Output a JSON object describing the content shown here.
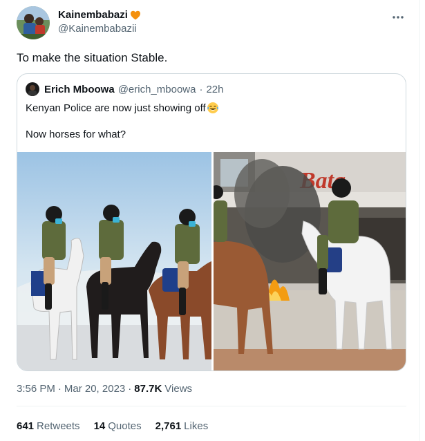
{
  "author": {
    "display_name": "Kainembabazi",
    "handle": "@Kainembabazii",
    "name_badge_icon": "orange-heart-icon",
    "avatar_icon": "avatar-image"
  },
  "tweet": {
    "text": "To make the situation Stable."
  },
  "quote": {
    "display_name": "Erich Mboowa",
    "handle": "@erich_mboowa",
    "dot": "·",
    "time": "22h",
    "line1": "Kenyan Police are now just showing off",
    "line1_emoji_icon": "tears-of-joy-emoji",
    "line2": "Now horses for what?",
    "media": [
      {
        "name": "mounted-police-on-street-photo"
      },
      {
        "name": "mounted-police-near-fire-photo",
        "sign_text": "Bata"
      }
    ]
  },
  "meta": {
    "time": "3:56 PM",
    "sep1": "·",
    "date": "Mar 20, 2023",
    "sep2": "·",
    "views_count": "87.7K",
    "views_label": "Views"
  },
  "stats": {
    "retweets_count": "641",
    "retweets_label": "Retweets",
    "quotes_count": "14",
    "quotes_label": "Quotes",
    "likes_count": "2,761",
    "likes_label": "Likes"
  },
  "colors": {
    "primary_text": "#0f1419",
    "secondary_text": "#536471",
    "border": "#cfd9de",
    "heart": "#f4900c"
  }
}
